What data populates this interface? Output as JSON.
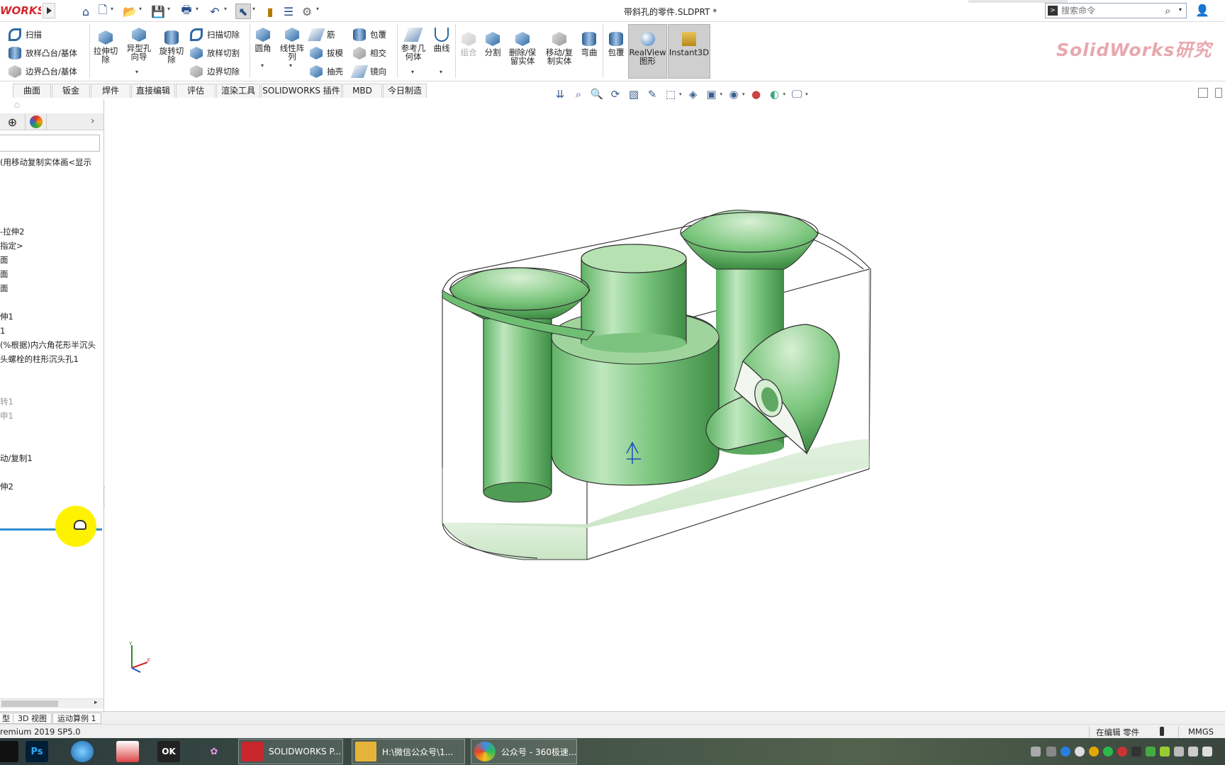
{
  "titlebar": {
    "logo_text": "WORKS",
    "doc_title": "带斜孔的零件.SLDPRT *",
    "search_placeholder": "搜索命令",
    "quick_access": [
      "home-icon",
      "new-icon",
      "open-icon",
      "save-icon",
      "print-icon",
      "undo-icon",
      "select-icon",
      "traffic-light-icon",
      "file-properties-icon",
      "options-icon"
    ]
  },
  "ribbon": {
    "sweep": "扫描",
    "loft": "放样凸台/基体",
    "boundary": "边界凸台/基体",
    "extruded_cut": "拉伸切\n除",
    "hole_wizard": "异型孔\n向导",
    "revolved_cut": "旋转切\n除",
    "swept_cut": "扫描切除",
    "lofted_cut": "放样切割",
    "boundary_cut": "边界切除",
    "fillet": "圆角",
    "linear_pattern": "线性阵\n列",
    "rib": "筋",
    "draft": "拔模",
    "shell": "抽壳",
    "wrap": "包覆",
    "intersect": "相交",
    "mirror": "镜向",
    "ref_geometry": "参考几\n何体",
    "curves": "曲线",
    "combine": "组合",
    "split": "分割",
    "delete_keep": "删除/保\n留实体",
    "move_copy": "移动/复\n制实体",
    "flex": "弯曲",
    "wrap2": "包覆",
    "realview": "RealView\n图形",
    "instant3d": "Instant3D",
    "brand_text": "SolidWorks研究"
  },
  "tabs": [
    "曲面",
    "钣金",
    "焊件",
    "直接编辑",
    "评估",
    "渲染工具",
    "SOLIDWORKS 插件",
    "MBD",
    "今日制造"
  ],
  "left_panel": {
    "tree_items": [
      {
        "text": "(用移动复制实体画<显示",
        "dim": false
      },
      {
        "text": "-拉伸2",
        "dim": false
      },
      {
        "text": "指定>",
        "dim": false
      },
      {
        "text": "面",
        "dim": false
      },
      {
        "text": "面",
        "dim": false
      },
      {
        "text": "面",
        "dim": false
      },
      {
        "text": "伸1",
        "dim": false
      },
      {
        "text": "1",
        "dim": false
      },
      {
        "text": "(%根据)内六角花形半沉头",
        "dim": false
      },
      {
        "text": "头螺栓的柱形沉头孔1",
        "dim": false
      },
      {
        "text": "",
        "dim": false
      },
      {
        "text": "转1",
        "dim": true
      },
      {
        "text": "申1",
        "dim": true
      },
      {
        "text": "动/复制1",
        "dim": false
      },
      {
        "text": "伸2",
        "dim": false
      }
    ]
  },
  "bottom_tabs": [
    "型",
    "3D 视图",
    "运动算例 1"
  ],
  "status": {
    "left": "remium 2019 SP5.0",
    "mode": "在编辑 零件",
    "units": "MMGS"
  },
  "taskbar": {
    "tasks": [
      {
        "label": "SOLIDWORKS P...",
        "color": "#c8252c"
      },
      {
        "label": "H:\\微信公众号\\1...",
        "color": "#e6b33a"
      },
      {
        "label": "公众号 - 360极速...",
        "color": "#3f8ee8"
      }
    ]
  },
  "colors": {
    "accent": "#2e8fd0",
    "model_green": "#7fcf82",
    "brand_red": "#d3282f"
  }
}
